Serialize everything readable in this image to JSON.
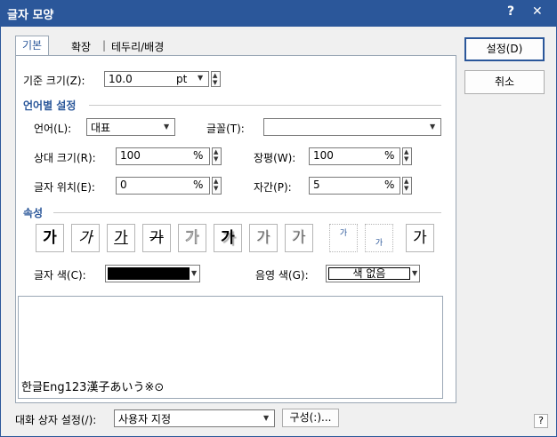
{
  "window": {
    "title": "글자 모양",
    "help_glyph": "?",
    "close_glyph": "✕",
    "accent": "#2b579a"
  },
  "tabs": [
    "기본",
    "확장",
    "테두리/배경"
  ],
  "buttons": {
    "ok": "설정(D)",
    "cancel": "취소"
  },
  "base_size": {
    "label": "기준 크기(Z):",
    "value": "10.0",
    "unit": "pt"
  },
  "lang_section": {
    "title": "언어별 설정",
    "language_label": "언어(L):",
    "language_value": "대표",
    "font_label": "글꼴(T):",
    "font_value": "",
    "rel_size_label": "상대 크기(R):",
    "rel_size_value": "100",
    "rel_size_unit": "%",
    "width_label": "장평(W):",
    "width_value": "100",
    "width_unit": "%",
    "position_label": "글자 위치(E):",
    "position_value": "0",
    "position_unit": "%",
    "spacing_label": "자간(P):",
    "spacing_value": "5",
    "spacing_unit": "%"
  },
  "attr_section": {
    "title": "속성",
    "items": [
      {
        "glyph": "가",
        "name": "bold"
      },
      {
        "glyph": "가",
        "name": "italic"
      },
      {
        "glyph": "가",
        "name": "underline"
      },
      {
        "glyph": "가",
        "name": "strikethrough"
      },
      {
        "glyph": "가",
        "name": "outline"
      },
      {
        "glyph": "가",
        "name": "shadow"
      },
      {
        "glyph": "가",
        "name": "emboss"
      },
      {
        "glyph": "가",
        "name": "engrave"
      },
      {
        "glyph": "가",
        "name": "superscript"
      },
      {
        "glyph": "가",
        "name": "subscript"
      },
      {
        "glyph": "가",
        "name": "normal"
      }
    ],
    "text_color_label": "글자 색(C):",
    "text_color": "#000000",
    "shade_color_label": "음영 색(G):",
    "shade_color_value": "색 없음"
  },
  "preview": {
    "text": "한글Eng123漢子あいう※⊙"
  },
  "footer": {
    "preset_label": "대화 상자 설정(/):",
    "preset_value": "사용자 지정",
    "config_button": "구성(:)...",
    "help_glyph": "?"
  }
}
